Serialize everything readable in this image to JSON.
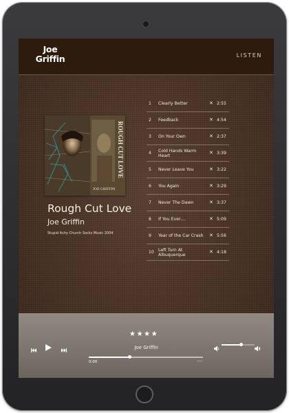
{
  "header": {
    "logo_line1": "Joe",
    "logo_line2": "Griffin",
    "nav_listen": "LISTEN"
  },
  "album": {
    "title": "Rough Cut Love",
    "artist": "Joe Griffin",
    "meta": "Stupid Itchy Church Socks Music 2004",
    "cover_text_artist": "JOE GRIFFIN",
    "cover_text_title": "ROUGH CUT LOVE"
  },
  "tracks": [
    {
      "num": "1",
      "title": "Clearly Better",
      "x": "✕",
      "duration": "2:55"
    },
    {
      "num": "2",
      "title": "Feedback",
      "x": "✕",
      "duration": "4:54"
    },
    {
      "num": "3",
      "title": "On Your Own",
      "x": "✕",
      "duration": "2:37"
    },
    {
      "num": "4",
      "title": "Cold Hands Warm Heart",
      "x": "✕",
      "duration": "3:39"
    },
    {
      "num": "5",
      "title": "Never Leave You",
      "x": "✕",
      "duration": "3:22"
    },
    {
      "num": "6",
      "title": "You Again",
      "x": "✕",
      "duration": "3:29"
    },
    {
      "num": "7",
      "title": "Never The Dawn",
      "x": "✕",
      "duration": "3:37"
    },
    {
      "num": "8",
      "title": "If You Ever....",
      "x": "✕",
      "duration": "5:09"
    },
    {
      "num": "9",
      "title": "Year of the Car Crash",
      "x": "✕",
      "duration": "5:56"
    },
    {
      "num": "10",
      "title": "Left Turn At Albuquerque",
      "x": "✕",
      "duration": "4:18"
    }
  ],
  "player": {
    "stars": "★★★★",
    "rating": 4,
    "artist": "Joe Griffin",
    "time_current": "0:00",
    "time_remaining": "-:--",
    "progress_fraction": 0.36,
    "volume_fraction": 0.6,
    "icons": {
      "prev": "previous-icon",
      "play": "play-icon",
      "next": "next-icon",
      "volume_low": "volume-low-icon",
      "volume_high": "volume-high-icon"
    }
  },
  "colors": {
    "topbar": "#2d1b0d",
    "background": "#4c3223",
    "player_bar": "#807870",
    "text": "#f4efe6"
  }
}
